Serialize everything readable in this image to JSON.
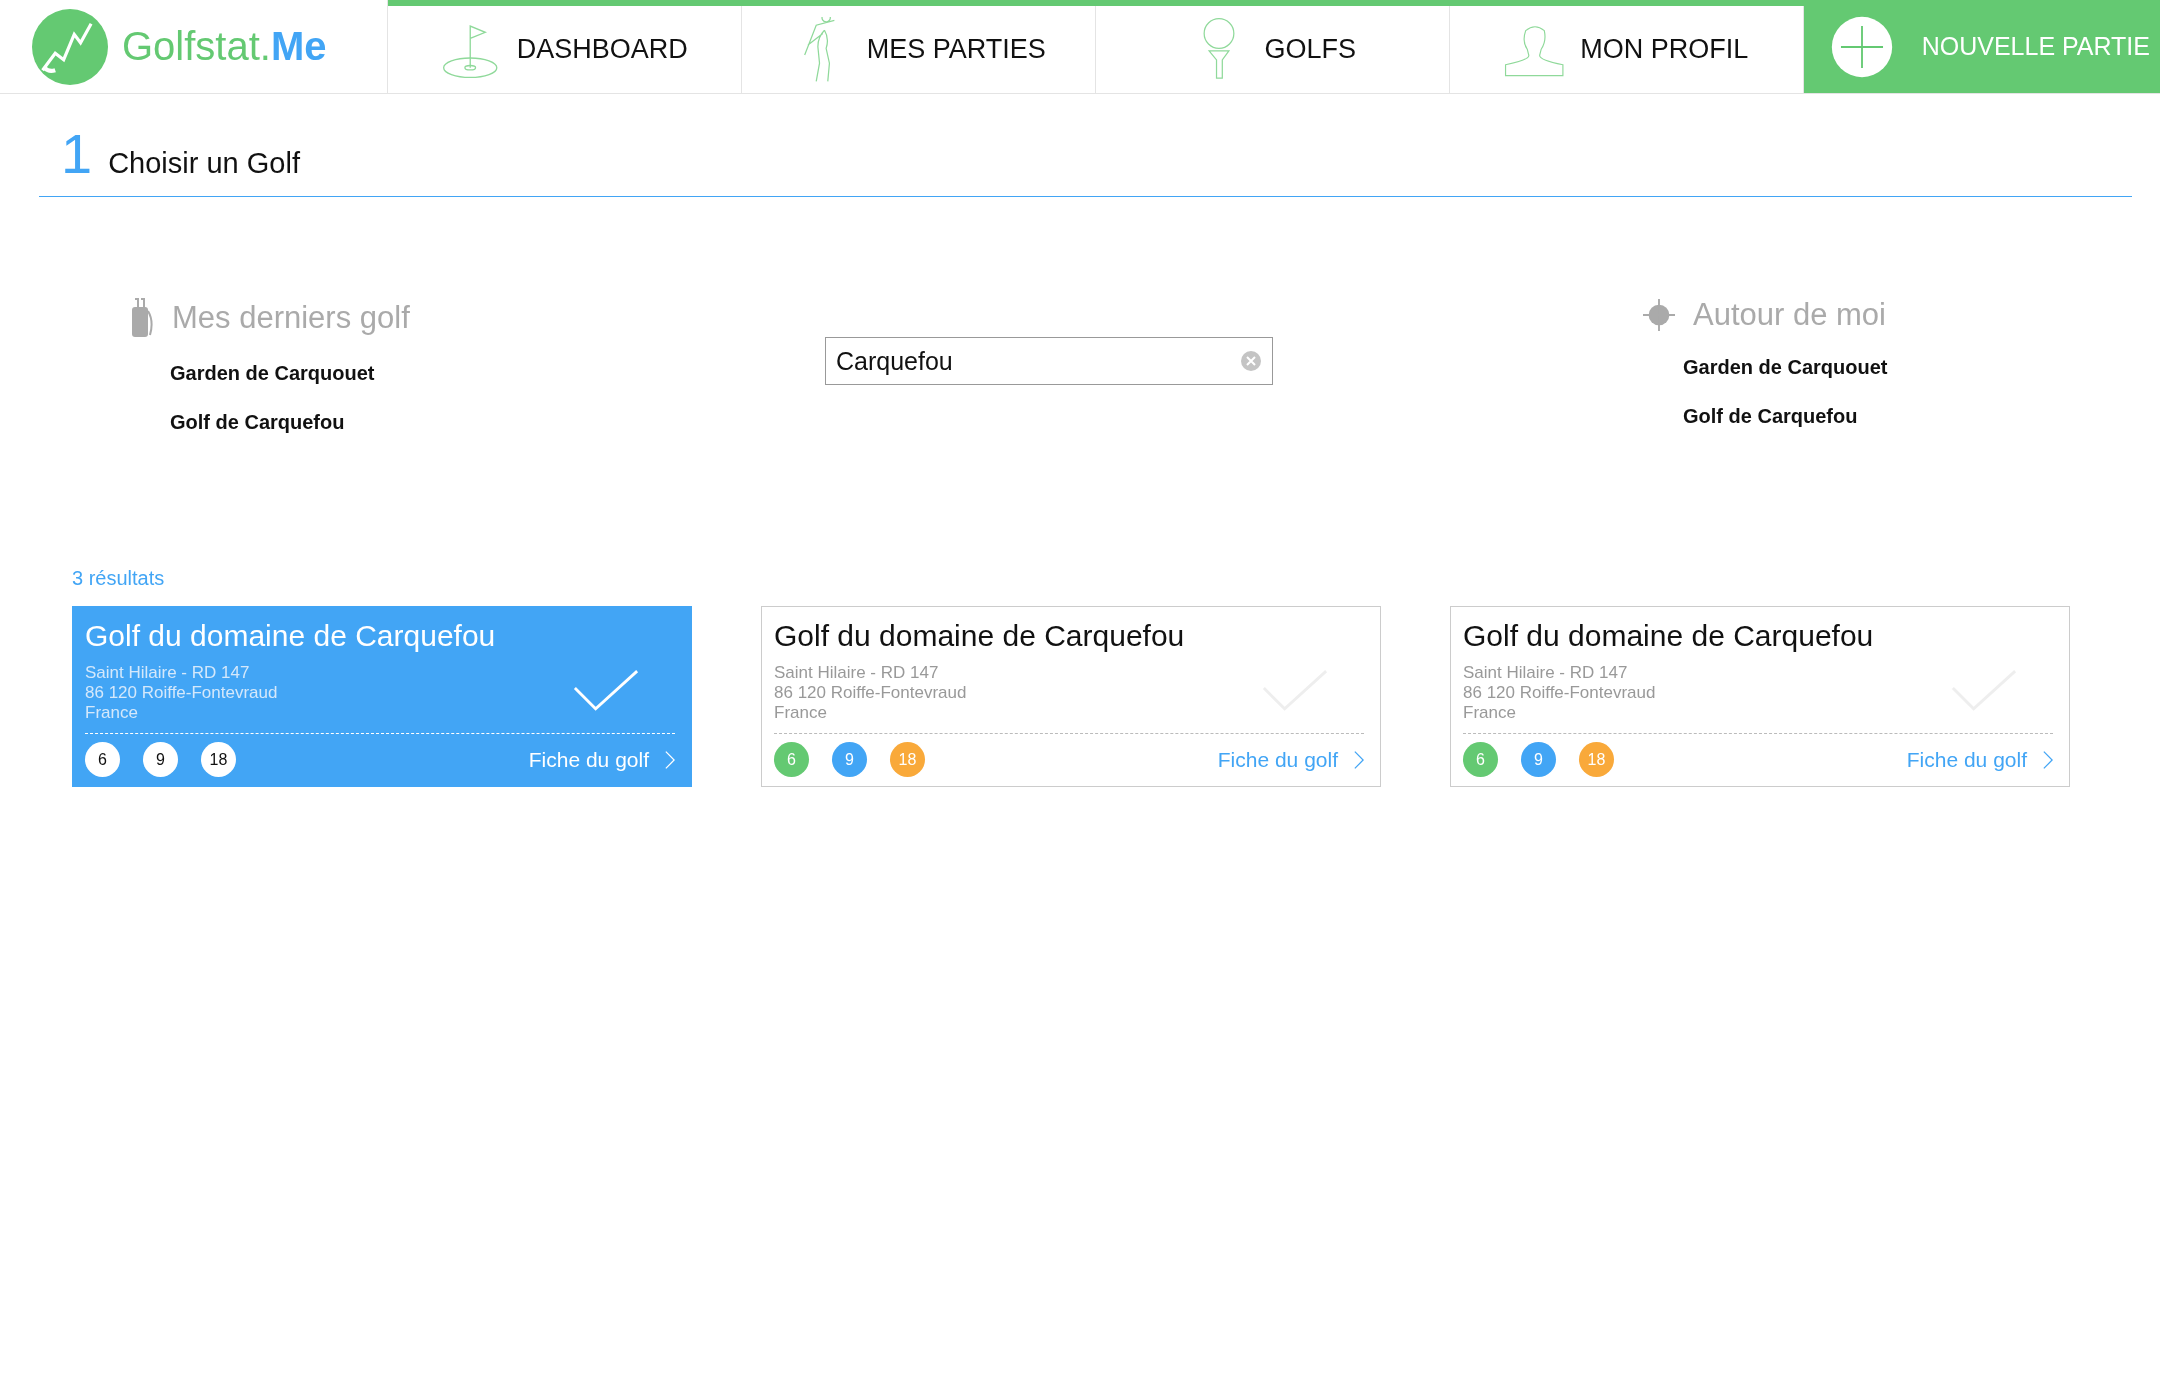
{
  "logo": {
    "text": "Golfstat.**Me**"
  },
  "nav": [
    {
      "label": "DASHBOARD",
      "kind": "flag"
    },
    {
      "label": "MES PARTIES",
      "kind": "golfer"
    },
    {
      "label": "GOLFS",
      "kind": "tee"
    },
    {
      "label": "MON PROFIL",
      "kind": "person"
    }
  ],
  "new_game_button": {
    "label": "NOUVELLE PARTIE"
  },
  "step": {
    "number": "1",
    "title": "Choisir un Golf"
  },
  "recent": {
    "title": "Mes derniers golf",
    "items": [
      "Garden de Carquouet",
      "Golf de Carquefou"
    ]
  },
  "search": {
    "value": "Carquefou"
  },
  "nearby": {
    "title": "Autour de moi",
    "items": [
      "Garden de Carquouet",
      "Golf de Carquefou"
    ]
  },
  "results": {
    "count": "3 résultats",
    "cards": [
      {
        "name": "Golf du domaine de Carquefou",
        "address": [
          "Saint Hilaire - RD 147",
          "86 120 Roiffe-Fontevraud",
          "France"
        ],
        "selected": true,
        "link": "Fiche du golf",
        "holes": [
          {
            "label": "6"
          },
          {
            "label": "9"
          },
          {
            "label": "18"
          }
        ]
      },
      {
        "name": "Golf du domaine de Carquefou",
        "address": [
          "Saint Hilaire - RD 147",
          "86 120 Roiffe-Fontevraud",
          "France"
        ],
        "selected": false,
        "link": "Fiche du golf",
        "holes": [
          {
            "label": "6",
            "color": "#64c972"
          },
          {
            "label": "9",
            "color": "#42a5f5"
          },
          {
            "label": "18",
            "color": "#f9a93a"
          }
        ]
      },
      {
        "name": "Golf du domaine de Carquefou",
        "address": [
          "Saint Hilaire - RD 147",
          "86 120 Roiffe-Fontevraud",
          "France"
        ],
        "selected": false,
        "link": "Fiche du golf",
        "holes": [
          {
            "label": "6",
            "color": "#64c972"
          },
          {
            "label": "9",
            "color": "#42a5f5"
          },
          {
            "label": "18",
            "color": "#f9a93a"
          }
        ]
      }
    ]
  }
}
